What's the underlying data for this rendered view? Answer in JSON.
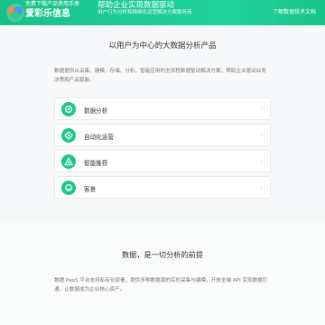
{
  "banner": {
    "brand_small": "免费下载产品使用手册",
    "brand_name": "爱彩乐信息",
    "slogan_main": "帮助企业实现数据驱动",
    "slogan_sub": "用户行为分析和精细化运营解决方案服务商",
    "top_link": "了解数据技术文档"
  },
  "hero": {
    "title": "以用户为中心的大数据分析产品",
    "description": "数据提供从采集、建模、存储、分析、智能应用的全流程数据驱动解决方案，帮助企业驱动业务决策和产品智能。"
  },
  "cards": [
    {
      "label": "数据分析",
      "icon": "analytics-icon"
    },
    {
      "label": "自动化运营",
      "icon": "automation-icon"
    },
    {
      "label": "智能推荐",
      "icon": "recommend-icon"
    },
    {
      "label": "客景",
      "icon": "customer-scene-icon"
    }
  ],
  "lower": {
    "title": "数据，是一切分析的前提",
    "description": "数据 PaaS 平台支持私有化部署，提供多种数据源的实时采集与建模，开放全端 API 实现数据打通，让数据成为企业核心资产。"
  },
  "colors": {
    "accent": "#1fcf97",
    "card_border": "#e9ecef"
  }
}
